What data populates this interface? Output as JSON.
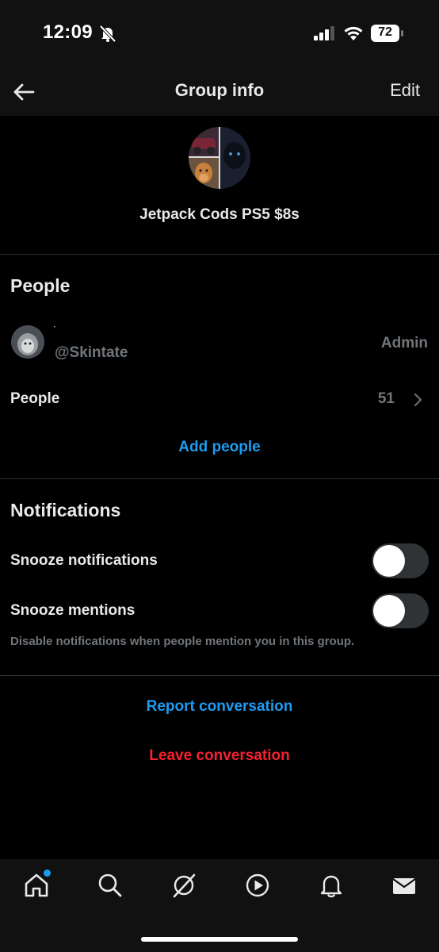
{
  "status_bar": {
    "time": "12:09",
    "battery": "72"
  },
  "header": {
    "title": "Group info",
    "edit_label": "Edit"
  },
  "group": {
    "name": "Jetpack Cods PS5 $8s"
  },
  "people_section": {
    "title": "People",
    "member": {
      "name": "·",
      "handle": "@Skintate",
      "role": "Admin"
    },
    "people_row": {
      "label": "People",
      "count": "51"
    },
    "add_people_label": "Add people"
  },
  "notifications_section": {
    "title": "Notifications",
    "snooze_notifications": {
      "label": "Snooze notifications",
      "enabled": false
    },
    "snooze_mentions": {
      "label": "Snooze mentions",
      "enabled": false
    },
    "hint": "Disable notifications when people mention you in this group."
  },
  "actions": {
    "report_label": "Report conversation",
    "leave_label": "Leave conversation"
  },
  "tab_bar": {
    "tabs": [
      "home-icon",
      "search-icon",
      "grok-icon",
      "play-icon",
      "bell-icon",
      "mail-icon"
    ],
    "active": "home-icon"
  },
  "colors": {
    "accent": "#1d9bf0",
    "danger": "#f4212e",
    "muted": "#71767b",
    "background": "#000000"
  }
}
